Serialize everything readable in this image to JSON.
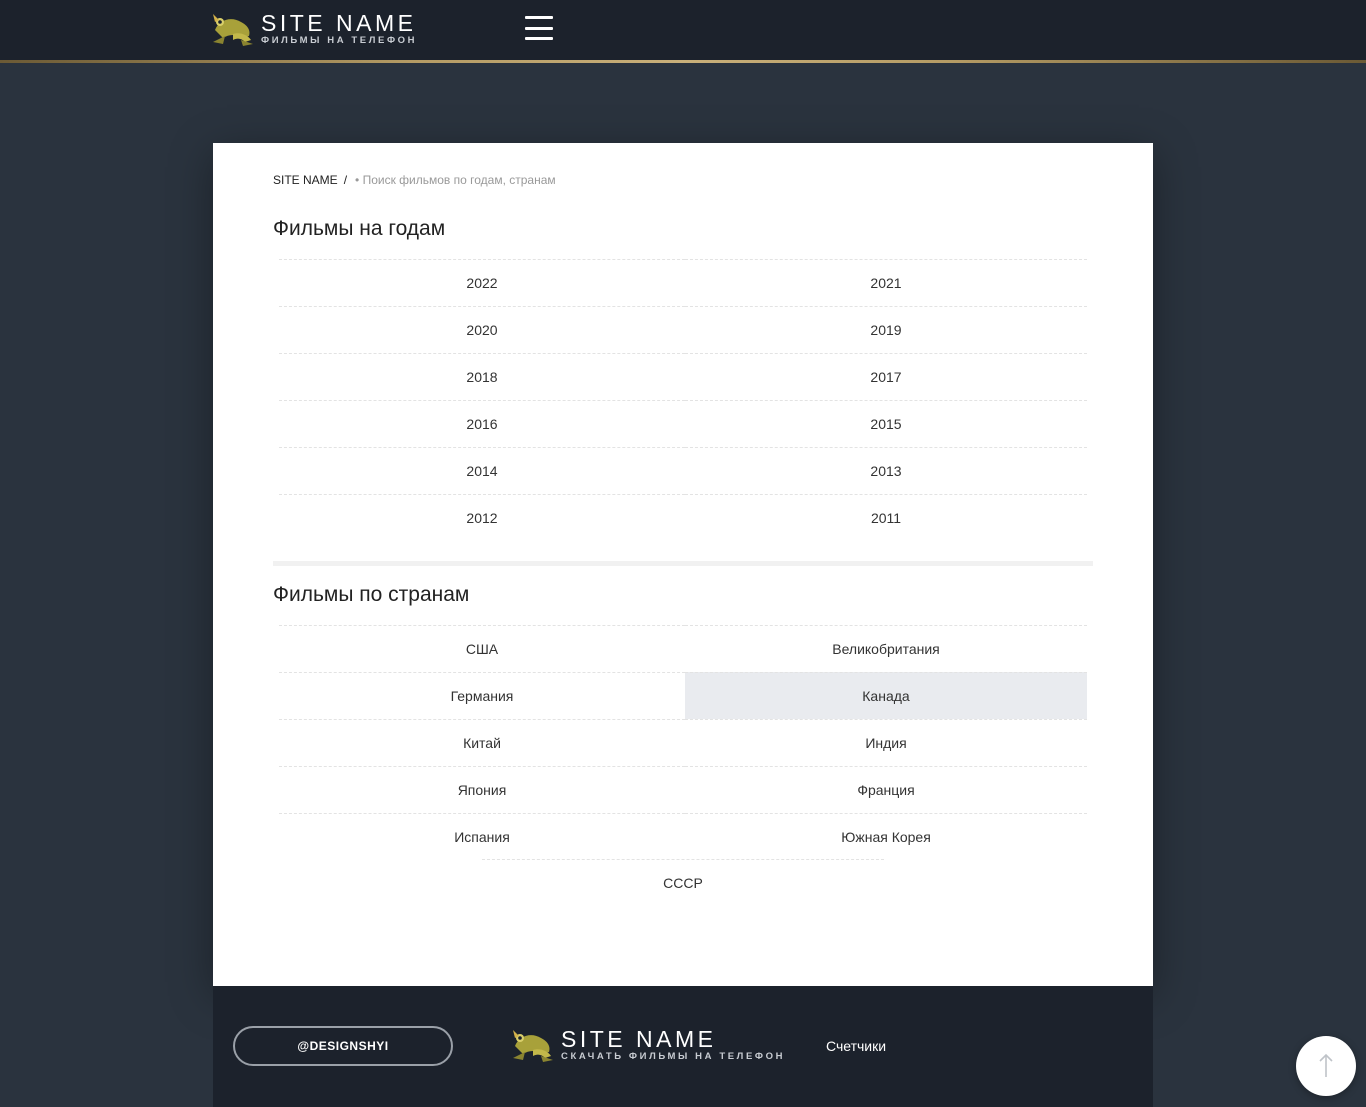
{
  "header": {
    "site_name": "SITE NAME",
    "tagline": "ФИЛЬМЫ НА ТЕЛЕФОН",
    "menu_icon": "hamburger-menu-icon"
  },
  "breadcrumb": {
    "home": "SITE NAME",
    "separator": "/",
    "current": "• Поиск фильмов по годам, странам"
  },
  "years_section": {
    "title": "Фильмы на годам",
    "items": [
      "2022",
      "2021",
      "2020",
      "2019",
      "2018",
      "2017",
      "2016",
      "2015",
      "2014",
      "2013",
      "2012",
      "2011"
    ]
  },
  "countries_section": {
    "title": "Фильмы по странам",
    "items": [
      "США",
      "Великобритания",
      "Германия",
      "Канада",
      "Китай",
      "Индия",
      "Япония",
      "Франция",
      "Испания",
      "Южная Корея"
    ],
    "last_item": "СССР",
    "highlighted": "Канада"
  },
  "footer": {
    "social_button": "@DESIGNSHYI",
    "site_name": "SITE NAME",
    "tagline": "СКАЧАТЬ ФИЛЬМЫ НА ТЕЛЕФОН",
    "counters_label": "Счетчики",
    "scroll_top_icon": "arrow-up-icon"
  },
  "colors": {
    "page_bg": "#2a333e",
    "header_bg": "#1c222c",
    "accent_gold": "#b49b64",
    "highlight_bg": "#e9ebef"
  }
}
